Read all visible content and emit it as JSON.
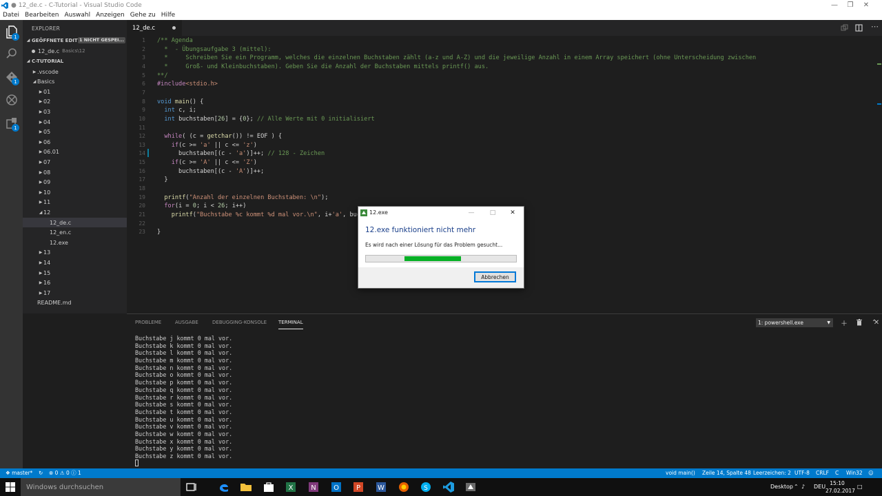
{
  "window": {
    "title": "● 12_de.c - C-Tutorial - Visual Studio Code"
  },
  "menu": [
    "Datei",
    "Bearbeiten",
    "Auswahl",
    "Anzeigen",
    "Gehe zu",
    "Hilfe"
  ],
  "activity_bar": {
    "badges": {
      "explorer": "1",
      "git": "1",
      "extensions": "1"
    }
  },
  "sidebar": {
    "title": "EXPLORER",
    "open_editors": {
      "label": "GEÖFFNETE EDITOREN",
      "badge": "1 NICHT GESPEI...",
      "items": [
        {
          "name": "12_de.c",
          "desc": "Basics\\12"
        }
      ]
    },
    "folder": {
      "label": "C-TUTORIAL",
      "items": [
        {
          "name": ".vscode",
          "indent": 1,
          "state": "collapsed"
        },
        {
          "name": "Basics",
          "indent": 1,
          "state": "expanded"
        },
        {
          "name": "01",
          "indent": 2,
          "state": "collapsed"
        },
        {
          "name": "02",
          "indent": 2,
          "state": "collapsed"
        },
        {
          "name": "03",
          "indent": 2,
          "state": "collapsed"
        },
        {
          "name": "04",
          "indent": 2,
          "state": "collapsed"
        },
        {
          "name": "05",
          "indent": 2,
          "state": "collapsed"
        },
        {
          "name": "06",
          "indent": 2,
          "state": "collapsed"
        },
        {
          "name": "06.01",
          "indent": 2,
          "state": "collapsed"
        },
        {
          "name": "07",
          "indent": 2,
          "state": "collapsed"
        },
        {
          "name": "08",
          "indent": 2,
          "state": "collapsed"
        },
        {
          "name": "09",
          "indent": 2,
          "state": "collapsed"
        },
        {
          "name": "10",
          "indent": 2,
          "state": "collapsed"
        },
        {
          "name": "11",
          "indent": 2,
          "state": "collapsed"
        },
        {
          "name": "12",
          "indent": 2,
          "state": "expanded"
        },
        {
          "name": "12_de.c",
          "indent": 3,
          "state": "file",
          "selected": true
        },
        {
          "name": "12_en.c",
          "indent": 3,
          "state": "file"
        },
        {
          "name": "12.exe",
          "indent": 3,
          "state": "file"
        },
        {
          "name": "13",
          "indent": 2,
          "state": "collapsed"
        },
        {
          "name": "14",
          "indent": 2,
          "state": "collapsed"
        },
        {
          "name": "15",
          "indent": 2,
          "state": "collapsed"
        },
        {
          "name": "16",
          "indent": 2,
          "state": "collapsed"
        },
        {
          "name": "17",
          "indent": 2,
          "state": "collapsed"
        },
        {
          "name": "README.md",
          "indent": 1,
          "state": "file"
        }
      ]
    }
  },
  "editor": {
    "tab_label": "12_de.c",
    "lines": [
      {
        "n": "1",
        "tokens": [
          [
            "c",
            "/** Agenda"
          ]
        ]
      },
      {
        "n": "2",
        "tokens": [
          [
            "c",
            "  *  - Übungsaufgabe 3 (mittel):"
          ]
        ]
      },
      {
        "n": "3",
        "tokens": [
          [
            "c",
            "  *     Schreiben Sie ein Programm, welches die einzelnen Buchstaben zählt (a-z und A-Z) und die jeweilige Anzahl in einem Array speichert (ohne Unterscheidung zwischen"
          ]
        ]
      },
      {
        "n": "4",
        "tokens": [
          [
            "c",
            "  *     Groß- und Kleinbuchstaben). Geben Sie die Anzahl der Buchstaben mittels printf() aus."
          ]
        ]
      },
      {
        "n": "5",
        "tokens": [
          [
            "c",
            "**/"
          ]
        ]
      },
      {
        "n": "6",
        "tokens": [
          [
            "p",
            "#include"
          ],
          [
            "s",
            "<stdio.h>"
          ]
        ]
      },
      {
        "n": "7",
        "tokens": []
      },
      {
        "n": "8",
        "tokens": [
          [
            "k",
            "void"
          ],
          [
            "t",
            " "
          ],
          [
            "f",
            "main"
          ],
          [
            "t",
            "() {"
          ]
        ]
      },
      {
        "n": "9",
        "tokens": [
          [
            "t",
            "  "
          ],
          [
            "k",
            "int"
          ],
          [
            "t",
            " c, i;"
          ]
        ]
      },
      {
        "n": "10",
        "tokens": [
          [
            "t",
            "  "
          ],
          [
            "k",
            "int"
          ],
          [
            "t",
            " buchstaben["
          ],
          [
            "n",
            "26"
          ],
          [
            "t",
            "] = {"
          ],
          [
            "n",
            "0"
          ],
          [
            "t",
            "}; "
          ],
          [
            "c",
            "// Alle Werte mit 0 initialisiert"
          ]
        ]
      },
      {
        "n": "11",
        "tokens": []
      },
      {
        "n": "12",
        "tokens": [
          [
            "t",
            "  "
          ],
          [
            "p",
            "while"
          ],
          [
            "t",
            "( (c = "
          ],
          [
            "f",
            "getchar"
          ],
          [
            "t",
            "()) != EOF ) {"
          ]
        ]
      },
      {
        "n": "13",
        "tokens": [
          [
            "t",
            "    "
          ],
          [
            "p",
            "if"
          ],
          [
            "t",
            "(c >= "
          ],
          [
            "s",
            "'a'"
          ],
          [
            "t",
            " || c <= "
          ],
          [
            "s",
            "'z'"
          ],
          [
            "t",
            ")"
          ]
        ]
      },
      {
        "n": "14",
        "tokens": [
          [
            "t",
            "      buchstaben[(c - "
          ],
          [
            "s",
            "'a'"
          ],
          [
            "t",
            ")]++; "
          ],
          [
            "c",
            "// 128 - Zeichen"
          ]
        ]
      },
      {
        "n": "15",
        "tokens": [
          [
            "t",
            "    "
          ],
          [
            "p",
            "if"
          ],
          [
            "t",
            "(c >= "
          ],
          [
            "s",
            "'A'"
          ],
          [
            "t",
            " || c <= "
          ],
          [
            "s",
            "'Z'"
          ],
          [
            "t",
            ")"
          ]
        ]
      },
      {
        "n": "16",
        "tokens": [
          [
            "t",
            "      buchstaben[(c - "
          ],
          [
            "s",
            "'A'"
          ],
          [
            "t",
            ")]++;"
          ]
        ]
      },
      {
        "n": "17",
        "tokens": [
          [
            "t",
            "  }"
          ]
        ]
      },
      {
        "n": "18",
        "tokens": []
      },
      {
        "n": "19",
        "tokens": [
          [
            "t",
            "  "
          ],
          [
            "f",
            "printf"
          ],
          [
            "t",
            "("
          ],
          [
            "s",
            "\"Anzahl der einzelnen Buchstaben: \\n\""
          ],
          [
            "t",
            ");"
          ]
        ]
      },
      {
        "n": "20",
        "tokens": [
          [
            "t",
            "  "
          ],
          [
            "p",
            "for"
          ],
          [
            "t",
            "(i = "
          ],
          [
            "n",
            "0"
          ],
          [
            "t",
            "; i < "
          ],
          [
            "n",
            "26"
          ],
          [
            "t",
            "; i++)"
          ]
        ]
      },
      {
        "n": "21",
        "tokens": [
          [
            "t",
            "    "
          ],
          [
            "f",
            "printf"
          ],
          [
            "t",
            "("
          ],
          [
            "s",
            "\"Buchstabe %c kommt %d mal vor.\\n\""
          ],
          [
            "t",
            ", i+"
          ],
          [
            "s",
            "'a'"
          ],
          [
            "t",
            ", buc"
          ]
        ]
      },
      {
        "n": "22",
        "tokens": []
      },
      {
        "n": "23",
        "tokens": [
          [
            "t",
            "}"
          ]
        ]
      }
    ]
  },
  "panel": {
    "tabs": [
      {
        "label": "PROBLEME",
        "active": false
      },
      {
        "label": "AUSGABE",
        "active": false
      },
      {
        "label": "DEBUGGING-KONSOLE",
        "active": false
      },
      {
        "label": "TERMINAL",
        "active": true
      }
    ],
    "terminal_select": "1: powershell.exe",
    "terminal_lines": [
      "Buchstabe j kommt 0 mal vor.",
      "Buchstabe k kommt 0 mal vor.",
      "Buchstabe l kommt 0 mal vor.",
      "Buchstabe m kommt 0 mal vor.",
      "Buchstabe n kommt 0 mal vor.",
      "Buchstabe o kommt 0 mal vor.",
      "Buchstabe p kommt 0 mal vor.",
      "Buchstabe q kommt 0 mal vor.",
      "Buchstabe r kommt 0 mal vor.",
      "Buchstabe s kommt 0 mal vor.",
      "Buchstabe t kommt 0 mal vor.",
      "Buchstabe u kommt 0 mal vor.",
      "Buchstabe v kommt 0 mal vor.",
      "Buchstabe w kommt 0 mal vor.",
      "Buchstabe x kommt 0 mal vor.",
      "Buchstabe y kommt 0 mal vor.",
      "Buchstabe z kommt 0 mal vor."
    ]
  },
  "statusbar": {
    "branch": "master*",
    "errors": "0",
    "warnings": "0",
    "info": "1",
    "function": "void main()",
    "position": "Zeile 14, Spalte 48",
    "indent": "Leerzeichen: 2",
    "encoding": "UTF-8",
    "eol": "CRLF",
    "language": "C",
    "platform": "Win32"
  },
  "dialog": {
    "title": "12.exe",
    "heading": "12.exe funktioniert nicht mehr",
    "message": "Es wird nach einer Lösung für das Problem gesucht...",
    "progress": {
      "start": 0.25,
      "end": 0.63
    },
    "cancel_label": "Abbrechen"
  },
  "taskbar": {
    "search_placeholder": "Windows durchsuchen",
    "desktop_label": "Desktop",
    "language": "DEU",
    "time": "15:10",
    "date": "27.02.2017"
  },
  "colors": {
    "accent": "#007acc",
    "progress": "#06b025",
    "editor_bg": "#1e1e1e"
  }
}
